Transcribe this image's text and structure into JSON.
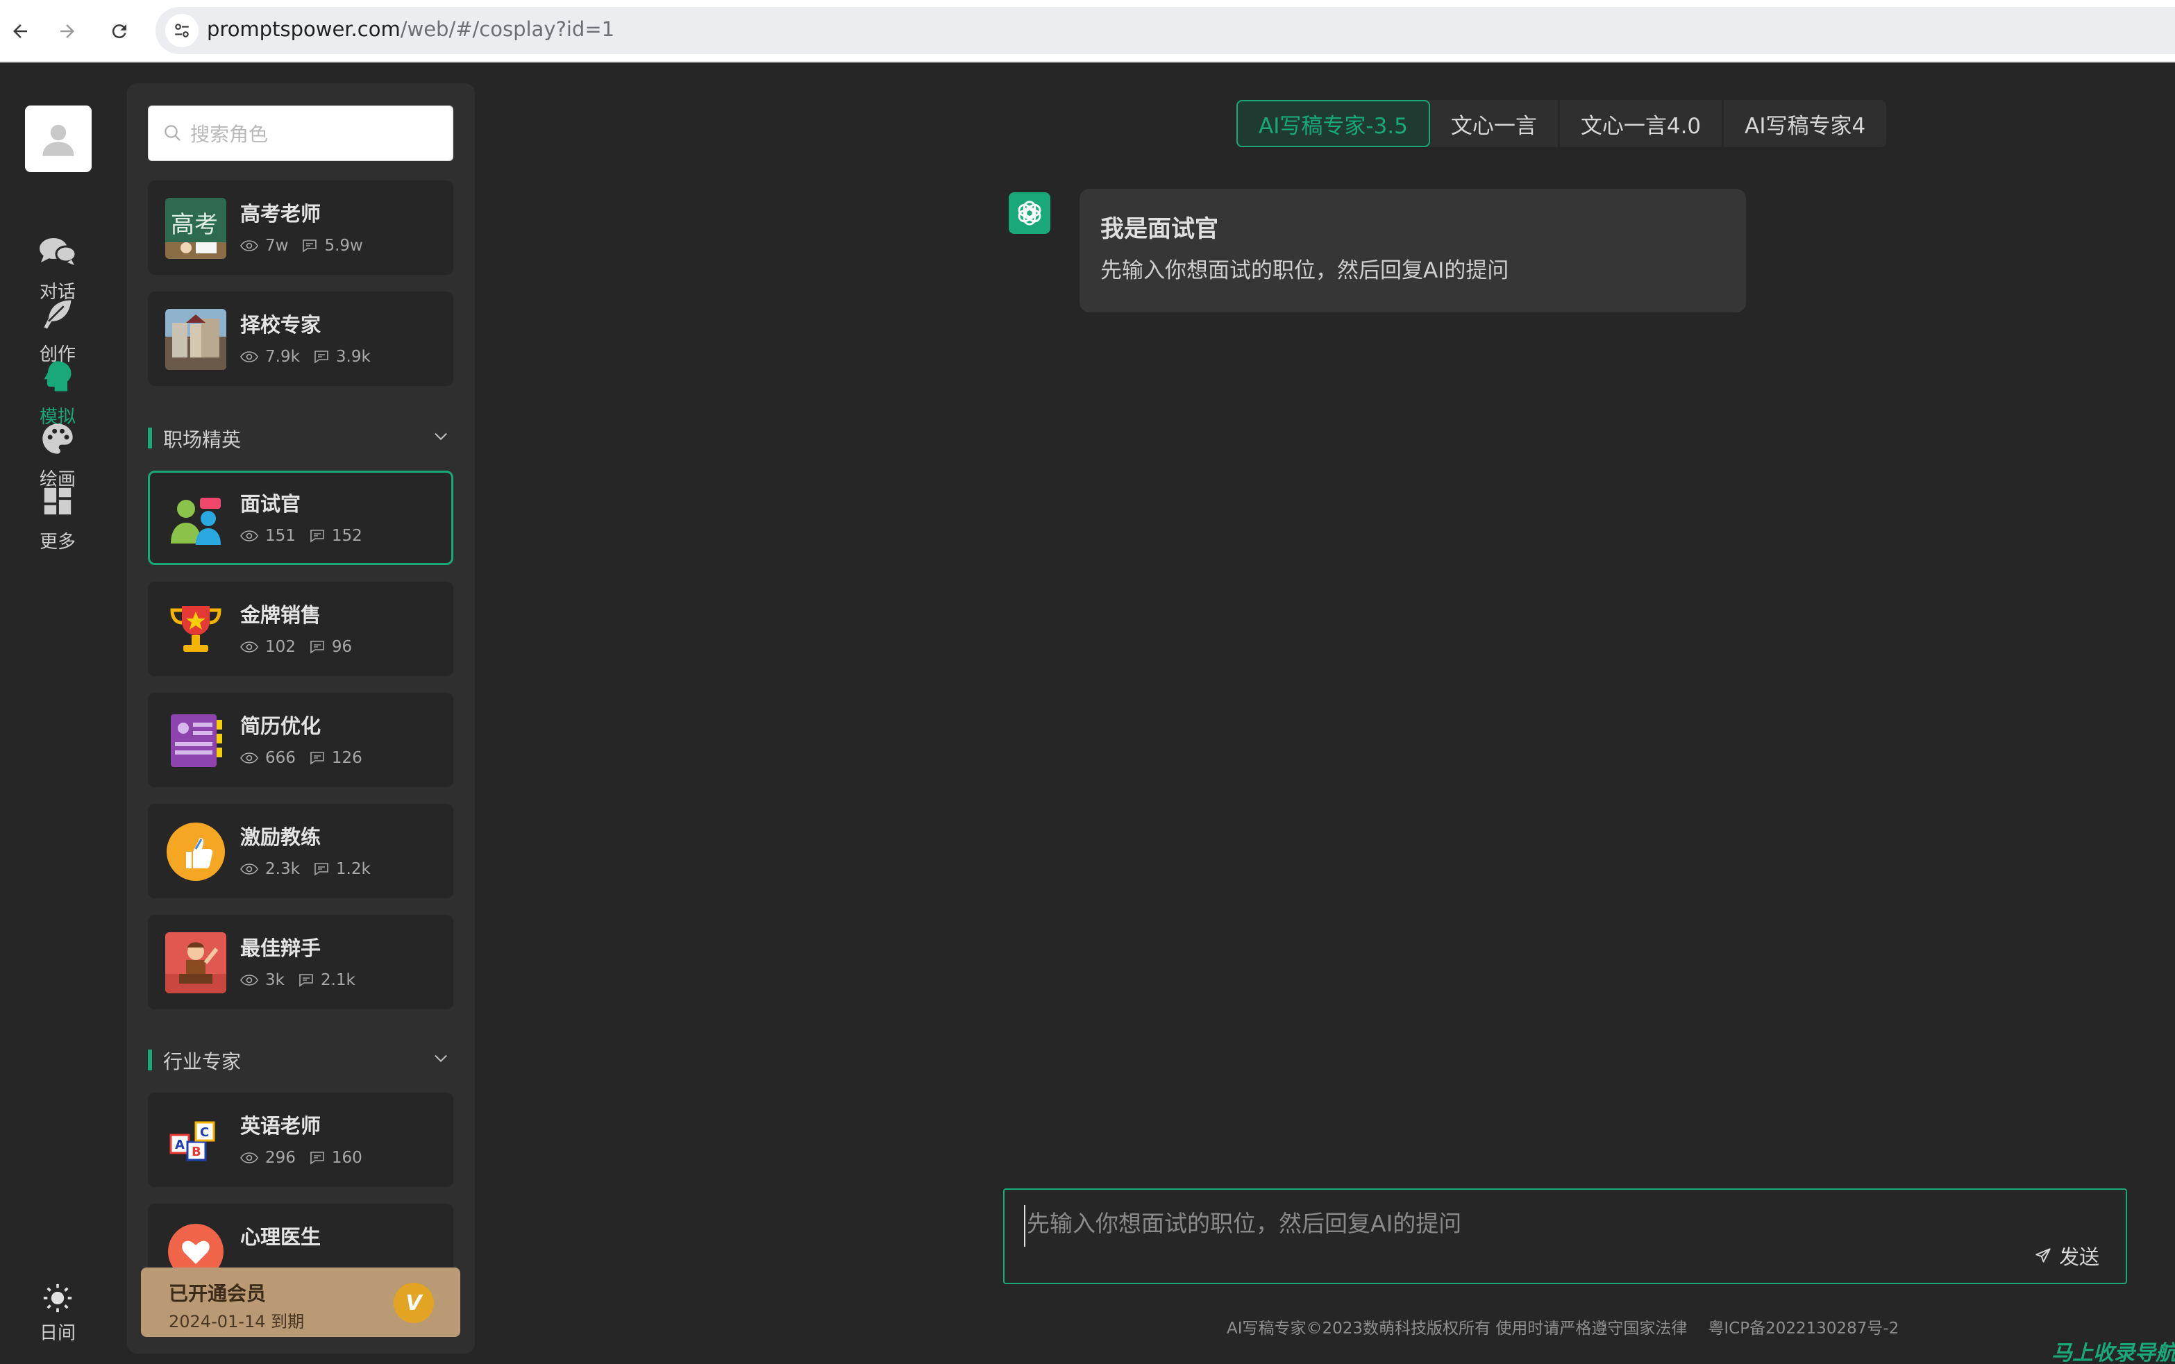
{
  "browser": {
    "url_host": "promptspower.com",
    "url_path": "/web/#/cosplay?id=1"
  },
  "rail": {
    "items": [
      {
        "label": "对话",
        "icon": "chat-icon"
      },
      {
        "label": "创作",
        "icon": "feather-icon"
      },
      {
        "label": "模拟",
        "icon": "head-icon",
        "active": true
      },
      {
        "label": "绘画",
        "icon": "palette-icon"
      },
      {
        "label": "更多",
        "icon": "grid-icon"
      }
    ],
    "mode_label": "日间"
  },
  "search": {
    "placeholder": "搜索角色"
  },
  "roles_top": [
    {
      "name": "高考老师",
      "views": "7w",
      "comments": "5.9w"
    },
    {
      "name": "择校专家",
      "views": "7.9k",
      "comments": "3.9k"
    }
  ],
  "sections": {
    "workplace": {
      "title": "职场精英",
      "roles": [
        {
          "name": "面试官",
          "views": "151",
          "comments": "152",
          "selected": true
        },
        {
          "name": "金牌销售",
          "views": "102",
          "comments": "96"
        },
        {
          "name": "简历优化",
          "views": "666",
          "comments": "126"
        },
        {
          "name": "激励教练",
          "views": "2.3k",
          "comments": "1.2k"
        },
        {
          "name": "最佳辩手",
          "views": "3k",
          "comments": "2.1k"
        }
      ]
    },
    "industry": {
      "title": "行业专家",
      "roles": [
        {
          "name": "英语老师",
          "views": "296",
          "comments": "160"
        },
        {
          "name": "心理医生",
          "views": "",
          "comments": ""
        }
      ]
    }
  },
  "vip": {
    "title": "已开通会员",
    "expiry": "2024-01-14 到期",
    "badge": "V"
  },
  "models": {
    "tabs": [
      "AI写稿专家-3.5",
      "文心一言",
      "文心一言4.0",
      "AI写稿专家4"
    ],
    "active_index": 0
  },
  "message": {
    "title": "我是面试官",
    "text": "先输入你想面试的职位，然后回复AI的提问"
  },
  "composer": {
    "placeholder": "先输入你想面试的职位，然后回复AI的提问",
    "send_label": "发送"
  },
  "footer": {
    "copyright": "AI写稿专家©2023数萌科技版权所有 使用时请严格遵守国家法律",
    "icp": "粤ICP备2022130287号-2"
  },
  "watermark": "马上收录导航",
  "colors": {
    "accent": "#19a87a",
    "background": "#262626",
    "panel": "#2f2f2f",
    "bubble": "#363636",
    "vip": "#ba9a74"
  }
}
